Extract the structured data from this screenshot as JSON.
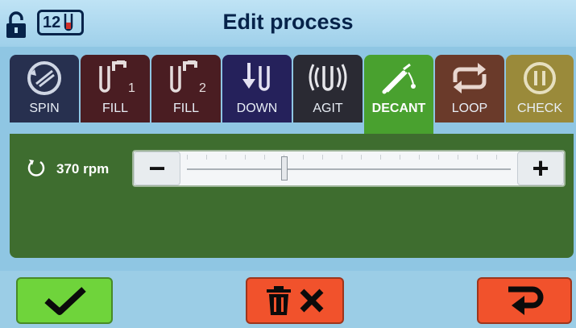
{
  "header": {
    "title": "Edit process",
    "tube_count": "12",
    "lock_state": "unlocked"
  },
  "tabs": [
    {
      "label": "SPIN",
      "icon": "spin-icon",
      "color": "#27304f",
      "active": false
    },
    {
      "label": "FILL",
      "icon": "fill-1-icon",
      "badge": "1",
      "color": "#4a1d22",
      "active": false
    },
    {
      "label": "FILL",
      "icon": "fill-2-icon",
      "badge": "2",
      "color": "#4a1d22",
      "active": false
    },
    {
      "label": "DOWN",
      "icon": "down-icon",
      "color": "#25215b",
      "active": false
    },
    {
      "label": "AGIT",
      "icon": "agitate-icon",
      "color": "#2a2a33",
      "active": false
    },
    {
      "label": "DECANT",
      "icon": "decant-icon",
      "color": "#49a12f",
      "active": true
    },
    {
      "label": "LOOP",
      "icon": "loop-icon",
      "color": "#6a3a2a",
      "active": false
    },
    {
      "label": "CHECK",
      "icon": "check-icon",
      "color": "#9a8a3a",
      "active": false
    }
  ],
  "speed": {
    "label": "370 rpm",
    "slider_fraction": 0.3
  },
  "buttons": {
    "minus": "−",
    "plus": "+"
  },
  "colors": {
    "accent_green": "#6fd43b",
    "accent_red": "#f1522c",
    "panel_green": "#3e6d2f",
    "background": "#8fc6e3"
  }
}
